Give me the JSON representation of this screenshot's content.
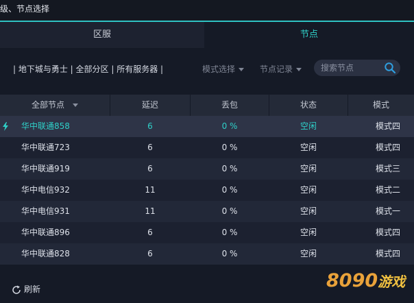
{
  "window": {
    "title": "级、节点选择"
  },
  "tabs": [
    {
      "label": "区服",
      "active": false
    },
    {
      "label": "节点",
      "active": true
    }
  ],
  "filters": {
    "breadcrumb": "| 地下城与勇士 | 全部分区 | 所有服务器 |",
    "mode_select": "模式选择",
    "record_select": "节点记录",
    "search_placeholder": "搜索节点"
  },
  "table": {
    "headers": [
      "全部节点",
      "延迟",
      "丢包",
      "状态",
      "模式"
    ],
    "rows": [
      {
        "name": "华中联通858",
        "delay": "6",
        "loss": "0 %",
        "status": "空闲",
        "mode": "模式四",
        "selected": true
      },
      {
        "name": "华中联通723",
        "delay": "6",
        "loss": "0 %",
        "status": "空闲",
        "mode": "模式四"
      },
      {
        "name": "华中联通919",
        "delay": "6",
        "loss": "0 %",
        "status": "空闲",
        "mode": "模式三"
      },
      {
        "name": "华中电信932",
        "delay": "11",
        "loss": "0 %",
        "status": "空闲",
        "mode": "模式二"
      },
      {
        "name": "华中电信931",
        "delay": "11",
        "loss": "0 %",
        "status": "空闲",
        "mode": "模式一"
      },
      {
        "name": "华中联通896",
        "delay": "6",
        "loss": "0 %",
        "status": "空闲",
        "mode": "模式四"
      },
      {
        "name": "华中联通828",
        "delay": "6",
        "loss": "0 %",
        "status": "空闲",
        "mode": "模式四"
      }
    ]
  },
  "footer": {
    "refresh_label": "刷新"
  },
  "watermark": {
    "number": "8090",
    "suffix": "游戏"
  },
  "colors": {
    "accent": "#2fc3c3",
    "background": "#151a26",
    "watermark": "#e9a23a"
  },
  "icons": {
    "search": "search-icon",
    "refresh": "refresh-icon",
    "selected_row": "lightning-icon",
    "dropdown": "chevron-down-icon"
  }
}
